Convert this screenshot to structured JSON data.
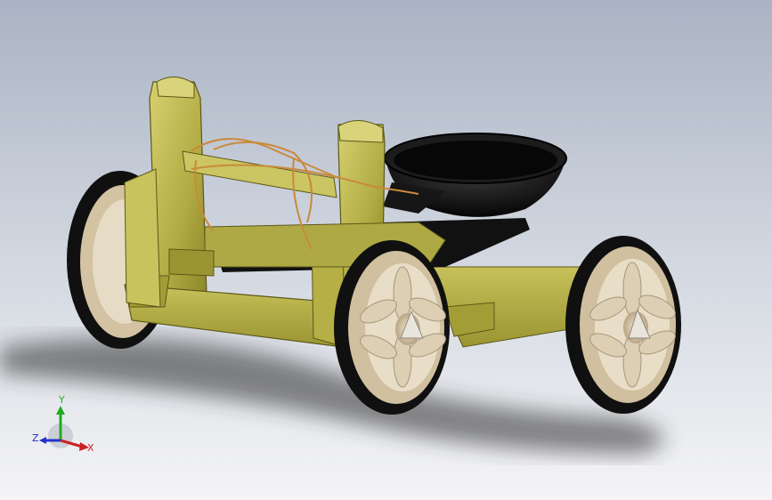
{
  "viewport": {
    "background_top": "#a9b3c3",
    "background_bottom": "#f4f4f6"
  },
  "model": {
    "body_color": "#b8b24c",
    "body_dark": "#7f7a25",
    "wheel_tire": "#111111",
    "wheel_hub": "#d8c8a8",
    "bucket": "#0b0b0b",
    "string_color": "#c98a3a"
  },
  "triad": {
    "x_label": "X",
    "y_label": "Y",
    "z_label": "Z",
    "x_color": "#cc2222",
    "y_color": "#22aa22",
    "z_color": "#2233cc"
  }
}
